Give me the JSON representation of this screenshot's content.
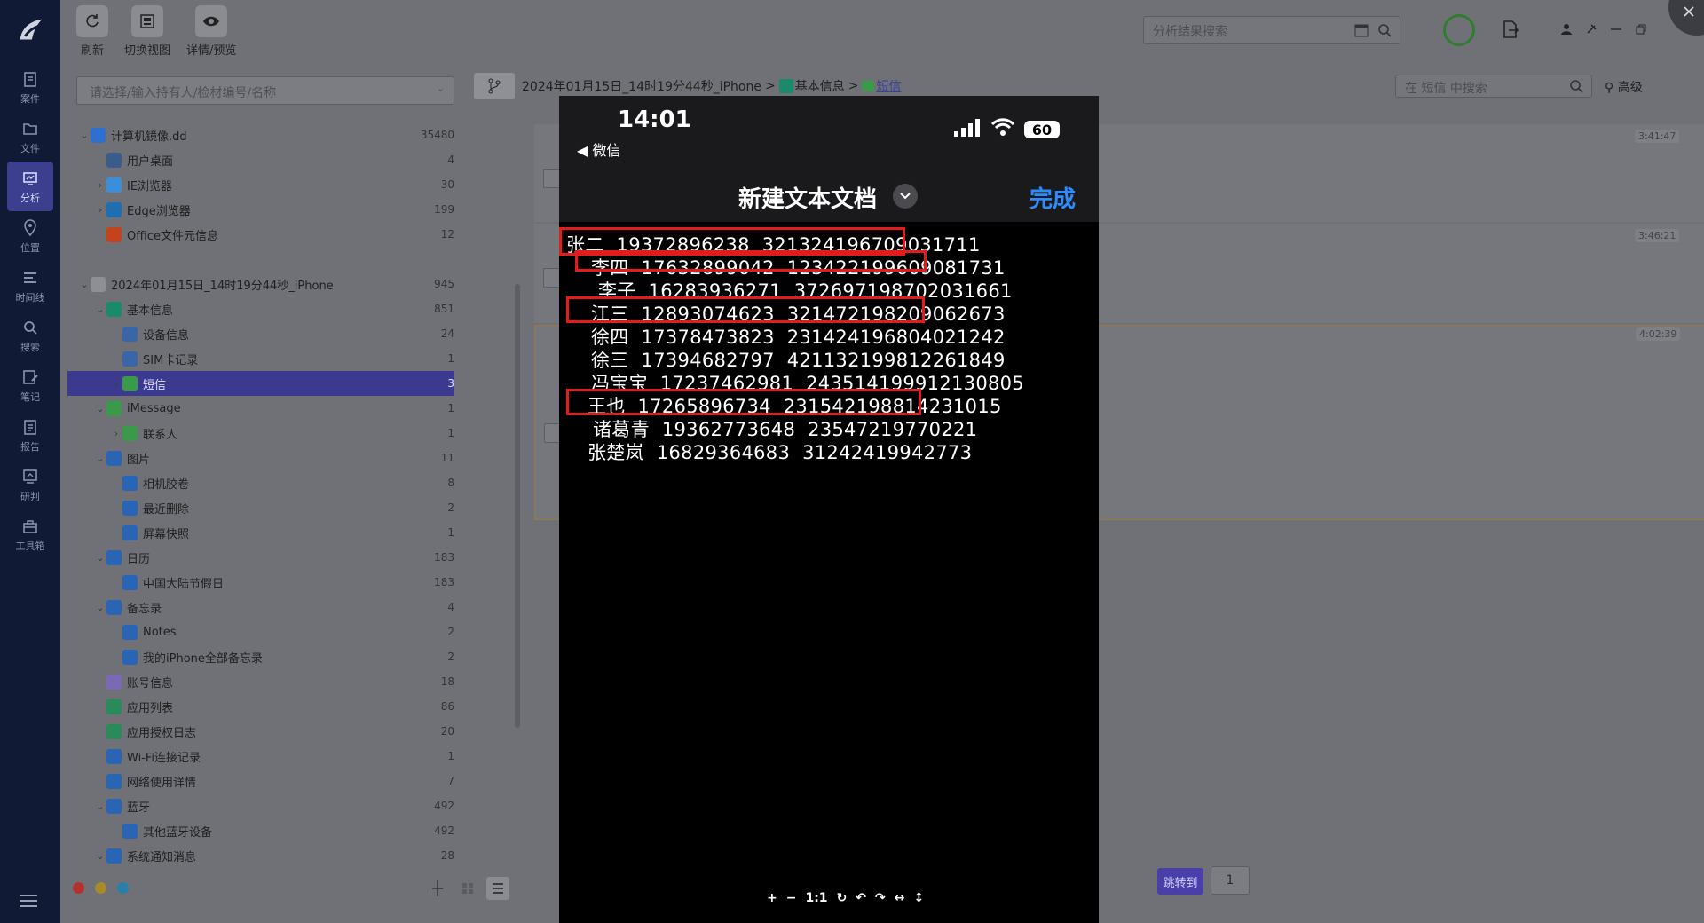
{
  "nav": {
    "items": [
      {
        "label": "案件",
        "icon": "case-icon"
      },
      {
        "label": "文件",
        "icon": "file-icon"
      },
      {
        "label": "分析",
        "icon": "analysis-icon",
        "active": true
      },
      {
        "label": "位置",
        "icon": "location-icon"
      },
      {
        "label": "时间线",
        "icon": "timeline-icon"
      },
      {
        "label": "搜索",
        "icon": "search-icon"
      },
      {
        "label": "笔记",
        "icon": "note-icon"
      },
      {
        "label": "报告",
        "icon": "report-icon"
      },
      {
        "label": "研判",
        "icon": "judge-icon"
      },
      {
        "label": "工具箱",
        "icon": "toolbox-icon"
      }
    ]
  },
  "toolbar": {
    "refresh": "刷新",
    "switch_view": "切换视图",
    "detail_preview": "详情/预览"
  },
  "top_search": {
    "placeholder": "分析结果搜索"
  },
  "tree_search": {
    "placeholder": "请选择/输入持有人/检材编号/名称"
  },
  "tree": [
    {
      "label": "计算机镜像.dd",
      "count": "35480",
      "level": 0,
      "chev": "v",
      "color": "#2f6fd0"
    },
    {
      "label": "用户桌面",
      "count": "4",
      "level": 1,
      "chev": "",
      "color": "#3a5c8a"
    },
    {
      "label": "IE浏览器",
      "count": "30",
      "level": 1,
      "chev": ">",
      "color": "#3c8ed8"
    },
    {
      "label": "Edge浏览器",
      "count": "199",
      "level": 1,
      "chev": ">",
      "color": "#1f6fb0"
    },
    {
      "label": "Office文件元信息",
      "count": "12",
      "level": 1,
      "chev": "",
      "color": "#c4431d"
    },
    {
      "label": "",
      "count": "",
      "level": 0,
      "chev": "",
      "color": ""
    },
    {
      "label": "2024年01月15日_14时19分44秒_iPhone",
      "count": "945",
      "level": 0,
      "chev": "v",
      "color": "#8c8f96"
    },
    {
      "label": "基本信息",
      "count": "851",
      "level": 1,
      "chev": "v",
      "color": "#1b8a6a"
    },
    {
      "label": "设备信息",
      "count": "24",
      "level": 2,
      "chev": "",
      "color": "#3a66a8"
    },
    {
      "label": "SIM卡记录",
      "count": "1",
      "level": 2,
      "chev": "",
      "color": "#3a66a8"
    },
    {
      "label": "短信",
      "count": "3",
      "level": 2,
      "chev": ">",
      "color": "#3a9a4a",
      "selected": true
    },
    {
      "label": "iMessage",
      "count": "1",
      "level": 1,
      "chev": "v",
      "color": "#3a9a4a"
    },
    {
      "label": "联系人",
      "count": "1",
      "level": 2,
      "chev": ">",
      "color": "#3a9a4a"
    },
    {
      "label": "图片",
      "count": "11",
      "level": 1,
      "chev": "v",
      "color": "#2a65b5"
    },
    {
      "label": "相机胶卷",
      "count": "8",
      "level": 2,
      "chev": "",
      "color": "#2a65b5"
    },
    {
      "label": "最近删除",
      "count": "2",
      "level": 2,
      "chev": "",
      "color": "#2a65b5"
    },
    {
      "label": "屏幕快照",
      "count": "1",
      "level": 2,
      "chev": "",
      "color": "#2a65b5"
    },
    {
      "label": "日历",
      "count": "183",
      "level": 1,
      "chev": "v",
      "color": "#2a65b5"
    },
    {
      "label": "中国大陆节假日",
      "count": "183",
      "level": 2,
      "chev": "",
      "color": "#2a65b5"
    },
    {
      "label": "备忘录",
      "count": "4",
      "level": 1,
      "chev": "v",
      "color": "#2a65b5"
    },
    {
      "label": "Notes",
      "count": "2",
      "level": 2,
      "chev": "",
      "color": "#2a65b5"
    },
    {
      "label": "我的iPhone全部备忘录",
      "count": "2",
      "level": 2,
      "chev": "",
      "color": "#2a65b5"
    },
    {
      "label": "账号信息",
      "count": "18",
      "level": 1,
      "chev": "",
      "color": "#7a6ab5"
    },
    {
      "label": "应用列表",
      "count": "86",
      "level": 1,
      "chev": "",
      "color": "#2a8a5a"
    },
    {
      "label": "应用授权日志",
      "count": "20",
      "level": 1,
      "chev": "",
      "color": "#2a8a5a"
    },
    {
      "label": "Wi-Fi连接记录",
      "count": "1",
      "level": 1,
      "chev": "",
      "color": "#2a65b5"
    },
    {
      "label": "网络使用详情",
      "count": "7",
      "level": 1,
      "chev": "",
      "color": "#2a65b5"
    },
    {
      "label": "蓝牙",
      "count": "492",
      "level": 1,
      "chev": "v",
      "color": "#2a65b5"
    },
    {
      "label": "其他蓝牙设备",
      "count": "492",
      "level": 2,
      "chev": "",
      "color": "#2a65b5"
    },
    {
      "label": "系统通知消息",
      "count": "28",
      "level": 1,
      "chev": "v",
      "color": "#2a65b5"
    }
  ],
  "breadcrumb": {
    "device": "2024年01月15日_14时19分44秒_iPhone",
    "sep": ">",
    "section": "基本信息",
    "current": "短信"
  },
  "right_search": {
    "placeholder": "在 短信 中搜索"
  },
  "advanced": "高级",
  "messages": [
    {
      "time": "3:41:47"
    },
    {
      "time": "3:46:21"
    },
    {
      "time": "4:02:39"
    }
  ],
  "pager": {
    "jump_label": "跳转到",
    "page": "1"
  },
  "phone": {
    "time": "14:01",
    "back": "◀ 微信",
    "battery": "60",
    "title": "新建文本文档",
    "done": "完成",
    "lines": [
      "张二  19372896238  321324196709031711",
      "李四  17632899042  123422199609081731",
      "李子  16283936271  372697198702031661",
      "江三  12893074623  321472198209062673",
      "徐四  17378473823  231424196804021242",
      "徐三  17394682797  421132199812261849",
      "冯宝宝  17237462981  243514199912130805",
      "王也  17265896734  231542198814231015",
      "诸葛青  19362773648  23547219770221",
      "张楚岚  16829364683  31242419942773"
    ],
    "controls": [
      "+",
      "−",
      "1:1",
      "↻",
      "↶",
      "↷",
      "↔",
      "↕"
    ]
  }
}
